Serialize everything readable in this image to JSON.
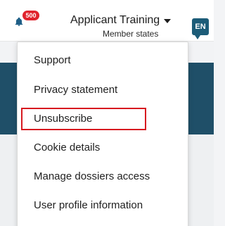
{
  "header": {
    "notification_count": "500",
    "account_title": "Applicant Training",
    "account_subtitle": "Member states",
    "language_code": "EN"
  },
  "menu": {
    "items": [
      {
        "label": "Support"
      },
      {
        "label": "Privacy statement"
      },
      {
        "label": "Unsubscribe"
      },
      {
        "label": "Cookie details"
      },
      {
        "label": "Manage dossiers access"
      },
      {
        "label": "User profile information"
      }
    ],
    "highlighted_item": "Unsubscribe"
  },
  "colors": {
    "banner": "#1f4f68",
    "badge": "#e0242e",
    "language_button": "#1d5c78",
    "highlight_border": "#d71920"
  },
  "icons": {
    "notification": "bell-icon",
    "dropdown_caret": "caret-down-icon"
  }
}
